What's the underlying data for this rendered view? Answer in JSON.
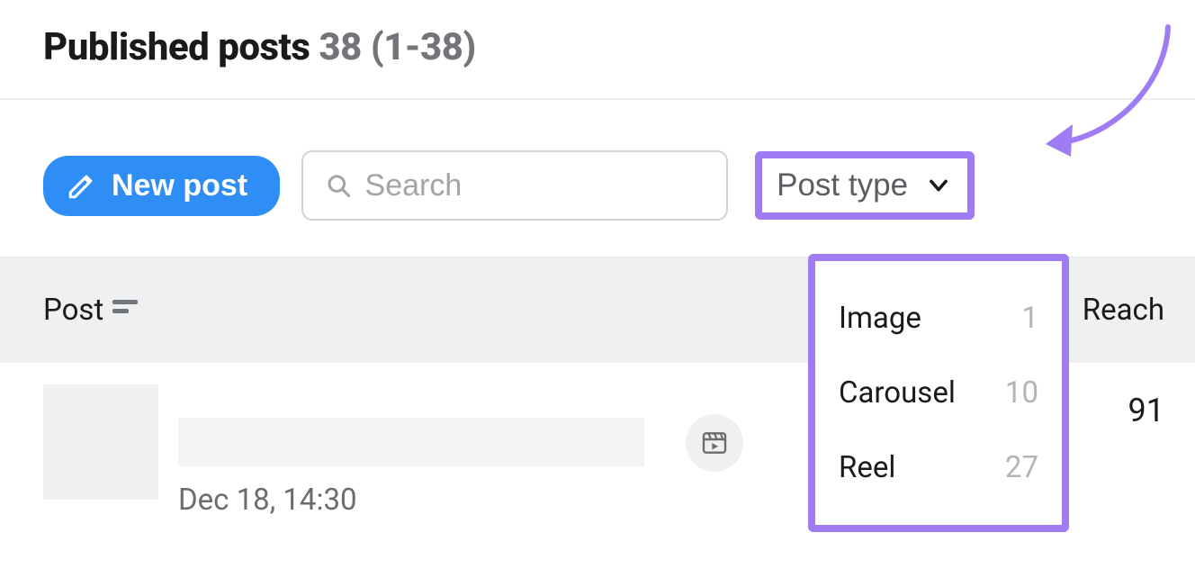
{
  "header": {
    "title": "Published posts",
    "count_text": "38 (1-38)"
  },
  "toolbar": {
    "new_post_label": "New post",
    "search_placeholder": "Search",
    "post_type_label": "Post type"
  },
  "dropdown": {
    "items": [
      {
        "label": "Image",
        "count": "1"
      },
      {
        "label": "Carousel",
        "count": "10"
      },
      {
        "label": "Reel",
        "count": "27"
      }
    ]
  },
  "table": {
    "columns": {
      "post": "Post",
      "reach": "Reach"
    }
  },
  "rows": [
    {
      "timestamp": "Dec 18, 14:30",
      "reach": "91"
    }
  ],
  "colors": {
    "accent_blue": "#2f8ef6",
    "highlight_purple": "#a07cf4"
  }
}
